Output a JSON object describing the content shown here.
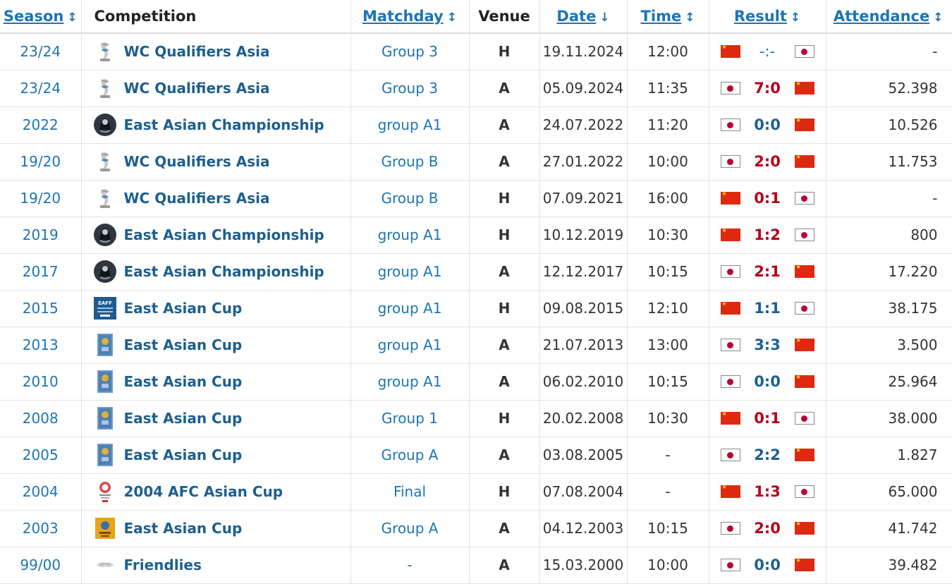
{
  "headers": {
    "season": "Season",
    "competition": "Competition",
    "matchday": "Matchday",
    "venue": "Venue",
    "date": "Date",
    "time": "Time",
    "result": "Result",
    "attendance": "Attendance"
  },
  "sort_icons": {
    "sortable": "↕",
    "active_desc": "↓"
  },
  "colors": {
    "link": "#1d75b3",
    "competition": "#1d5f8f",
    "loss": "#b3001b",
    "draw": "#1d5f8f",
    "china_flag": "#de2910",
    "japan_disc": "#bc002d"
  },
  "rows": [
    {
      "season": "23/24",
      "logo": "wc-qualifiers-icon",
      "competition": "WC Qualifiers Asia",
      "matchday": "Group 3",
      "venue": "H",
      "date": "19.11.2024",
      "time": "12:00",
      "home_flag": "cn",
      "score": "-:-",
      "outcome": "pending",
      "away_flag": "jp",
      "attendance": "-"
    },
    {
      "season": "23/24",
      "logo": "wc-qualifiers-icon",
      "competition": "WC Qualifiers Asia",
      "matchday": "Group 3",
      "venue": "A",
      "date": "05.09.2024",
      "time": "11:35",
      "home_flag": "jp",
      "score": "7:0",
      "outcome": "loss",
      "away_flag": "cn",
      "attendance": "52.398"
    },
    {
      "season": "2022",
      "logo": "east-asian-championship-icon",
      "competition": "East Asian Championship",
      "matchday": "group A1",
      "venue": "A",
      "date": "24.07.2022",
      "time": "11:20",
      "home_flag": "jp",
      "score": "0:0",
      "outcome": "draw",
      "away_flag": "cn",
      "attendance": "10.526"
    },
    {
      "season": "19/20",
      "logo": "wc-qualifiers-icon",
      "competition": "WC Qualifiers Asia",
      "matchday": "Group B",
      "venue": "A",
      "date": "27.01.2022",
      "time": "10:00",
      "home_flag": "jp",
      "score": "2:0",
      "outcome": "loss",
      "away_flag": "cn",
      "attendance": "11.753"
    },
    {
      "season": "19/20",
      "logo": "wc-qualifiers-icon",
      "competition": "WC Qualifiers Asia",
      "matchday": "Group B",
      "venue": "H",
      "date": "07.09.2021",
      "time": "16:00",
      "home_flag": "cn",
      "score": "0:1",
      "outcome": "loss",
      "away_flag": "jp",
      "attendance": "-"
    },
    {
      "season": "2019",
      "logo": "east-asian-championship-icon",
      "competition": "East Asian Championship",
      "matchday": "group A1",
      "venue": "H",
      "date": "10.12.2019",
      "time": "10:30",
      "home_flag": "cn",
      "score": "1:2",
      "outcome": "loss",
      "away_flag": "jp",
      "attendance": "800"
    },
    {
      "season": "2017",
      "logo": "east-asian-championship-icon",
      "competition": "East Asian Championship",
      "matchday": "group A1",
      "venue": "A",
      "date": "12.12.2017",
      "time": "10:15",
      "home_flag": "jp",
      "score": "2:1",
      "outcome": "loss",
      "away_flag": "cn",
      "attendance": "17.220"
    },
    {
      "season": "2015",
      "logo": "east-asian-cup-2015-icon",
      "competition": "East Asian Cup",
      "matchday": "group A1",
      "venue": "H",
      "date": "09.08.2015",
      "time": "12:10",
      "home_flag": "cn",
      "score": "1:1",
      "outcome": "draw",
      "away_flag": "jp",
      "attendance": "38.175"
    },
    {
      "season": "2013",
      "logo": "east-asian-cup-icon",
      "competition": "East Asian Cup",
      "matchday": "group A1",
      "venue": "A",
      "date": "21.07.2013",
      "time": "13:00",
      "home_flag": "jp",
      "score": "3:3",
      "outcome": "draw",
      "away_flag": "cn",
      "attendance": "3.500"
    },
    {
      "season": "2010",
      "logo": "east-asian-cup-icon",
      "competition": "East Asian Cup",
      "matchday": "group A1",
      "venue": "A",
      "date": "06.02.2010",
      "time": "10:15",
      "home_flag": "jp",
      "score": "0:0",
      "outcome": "draw",
      "away_flag": "cn",
      "attendance": "25.964"
    },
    {
      "season": "2008",
      "logo": "east-asian-cup-icon",
      "competition": "East Asian Cup",
      "matchday": "Group 1",
      "venue": "H",
      "date": "20.02.2008",
      "time": "10:30",
      "home_flag": "cn",
      "score": "0:1",
      "outcome": "loss",
      "away_flag": "jp",
      "attendance": "38.000"
    },
    {
      "season": "2005",
      "logo": "east-asian-cup-icon",
      "competition": "East Asian Cup",
      "matchday": "Group A",
      "venue": "A",
      "date": "03.08.2005",
      "time": "-",
      "home_flag": "jp",
      "score": "2:2",
      "outcome": "draw",
      "away_flag": "cn",
      "attendance": "1.827"
    },
    {
      "season": "2004",
      "logo": "afc-asian-cup-icon",
      "competition": "2004 AFC Asian Cup",
      "matchday": "Final",
      "venue": "H",
      "date": "07.08.2004",
      "time": "-",
      "home_flag": "cn",
      "score": "1:3",
      "outcome": "loss",
      "away_flag": "jp",
      "attendance": "65.000"
    },
    {
      "season": "2003",
      "logo": "east-asian-cup-2003-icon",
      "competition": "East Asian Cup",
      "matchday": "Group A",
      "venue": "A",
      "date": "04.12.2003",
      "time": "10:15",
      "home_flag": "jp",
      "score": "2:0",
      "outcome": "loss",
      "away_flag": "cn",
      "attendance": "41.742"
    },
    {
      "season": "99/00",
      "logo": "friendlies-icon",
      "competition": "Friendlies",
      "matchday": "-",
      "venue": "A",
      "date": "15.03.2000",
      "time": "10:00",
      "home_flag": "jp",
      "score": "0:0",
      "outcome": "draw",
      "away_flag": "cn",
      "attendance": "39.482"
    }
  ]
}
